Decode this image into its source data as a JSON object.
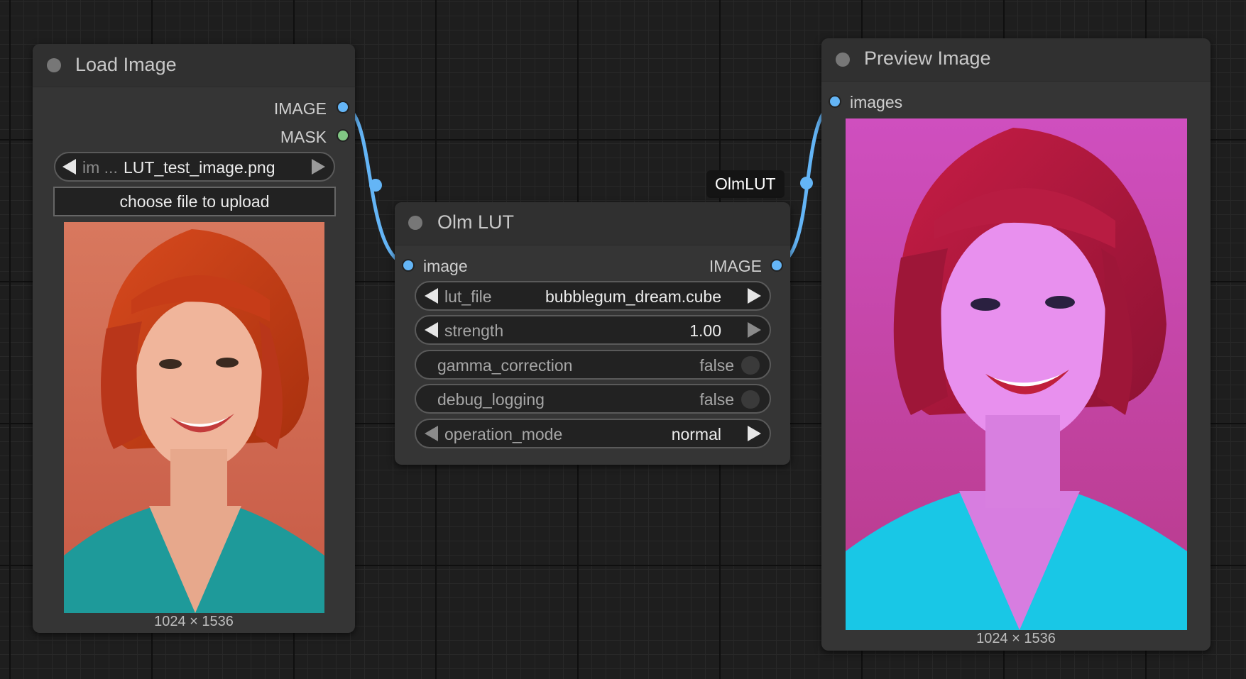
{
  "nodes": {
    "load_image": {
      "title": "Load Image",
      "outputs": [
        "IMAGE",
        "MASK"
      ],
      "image_widget": {
        "label": "im ...",
        "value": "LUT_test_image.png"
      },
      "upload_label": "choose file to upload",
      "image_size": "1024 × 1536"
    },
    "olm_lut": {
      "title": "Olm LUT",
      "badge": "OlmLUT",
      "input": "image",
      "output": "IMAGE",
      "widgets": [
        {
          "label": "lut_file",
          "value": "bubblegum_dream.cube"
        },
        {
          "label": "strength",
          "value": "1.00"
        },
        {
          "label": "gamma_correction",
          "value": "false"
        },
        {
          "label": "debug_logging",
          "value": "false"
        },
        {
          "label": "operation_mode",
          "value": "normal"
        }
      ]
    },
    "preview_image": {
      "title": "Preview Image",
      "input": "images",
      "image_size": "1024 × 1536"
    }
  },
  "colors": {
    "image_slot": "#64b5f6",
    "mask_slot": "#81c784",
    "link": "#64b5f6"
  },
  "icons": [
    "collapse-dot-icon",
    "left-arrow-icon",
    "right-arrow-icon",
    "toggle-off-icon"
  ]
}
